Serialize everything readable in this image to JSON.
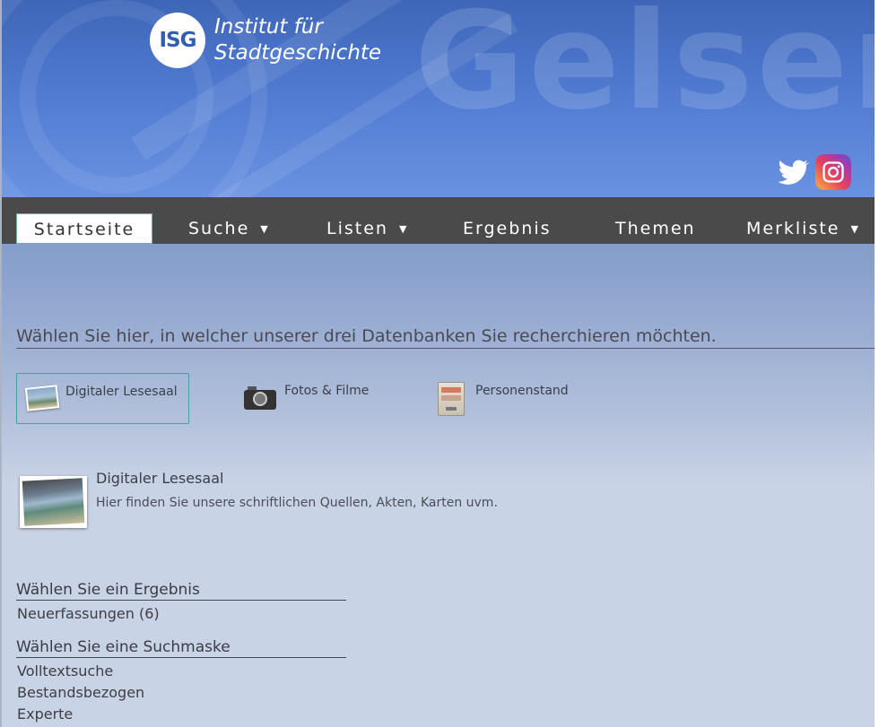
{
  "header": {
    "logo_abbrev": "ISG",
    "logo_line1": "Institut für",
    "logo_line2": "Stadtgeschichte",
    "watermark": "Gelsen"
  },
  "nav": {
    "items": [
      {
        "label": "Startseite",
        "active": true
      },
      {
        "label": "Suche",
        "has_dropdown": true
      },
      {
        "label": "Listen",
        "has_dropdown": true
      },
      {
        "label": "Ergebnis"
      },
      {
        "label": "Themen"
      },
      {
        "label": "Merkliste",
        "has_dropdown": true
      }
    ],
    "caret": "▼"
  },
  "main": {
    "choose_heading": "Wählen Sie hier, in welcher unserer drei Datenbanken Sie recherchieren möchten.",
    "databases": [
      {
        "label": "Digitaler Lesesaal",
        "icon": "photo-icon",
        "selected": true
      },
      {
        "label": "Fotos & Filme",
        "icon": "camera-icon"
      },
      {
        "label": "Personenstand",
        "icon": "cabinet-icon"
      }
    ],
    "detail": {
      "title": "Digitaler Lesesaal",
      "description": "Hier finden Sie unsere schriftlichen Quellen, Akten, Karten uvm."
    },
    "result_section": {
      "heading": "Wählen Sie ein Ergebnis",
      "links": [
        "Neuerfassungen (6)"
      ]
    },
    "search_section": {
      "heading": "Wählen Sie eine Suchmaske",
      "links": [
        "Volltextsuche",
        "Bestandsbezogen",
        "Experte"
      ]
    }
  },
  "colors": {
    "nav_bg": "#4a4a4a",
    "header_blue": "#4f7ad0",
    "selected_border": "#38a8a0"
  }
}
